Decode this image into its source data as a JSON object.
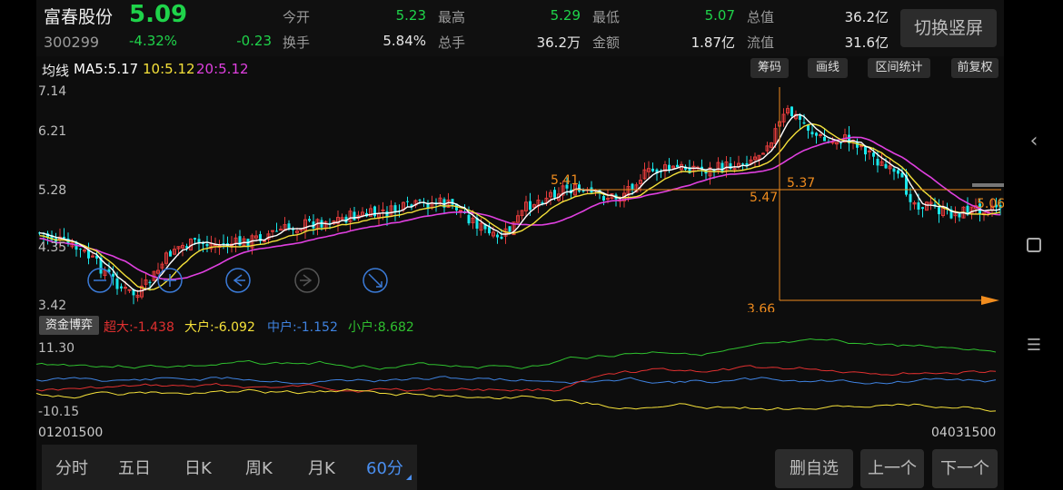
{
  "stock": {
    "name": "富春股份",
    "code": "300299",
    "price": "5.09",
    "change_pct": "-4.32%",
    "change": "-0.23"
  },
  "stats": [
    {
      "label": "今开",
      "value": "5.23",
      "color": "#1fd34a"
    },
    {
      "label": "最高",
      "value": "5.29",
      "color": "#1fd34a"
    },
    {
      "label": "最低",
      "value": "5.07",
      "color": "#1fd34a"
    },
    {
      "label": "总值",
      "value": "36.2亿",
      "color": "#e6e6e6"
    },
    {
      "label": "换手",
      "value": "5.84%",
      "color": "#e6e6e6"
    },
    {
      "label": "总手",
      "value": "36.2万",
      "color": "#e6e6e6"
    },
    {
      "label": "金额",
      "value": "1.87亿",
      "color": "#e6e6e6"
    },
    {
      "label": "流值",
      "value": "31.6亿",
      "color": "#e6e6e6"
    }
  ],
  "switch_button": "切换竖屏",
  "ma": {
    "title": "均线",
    "ma5": "MA5:5.17",
    "ma10": "10:5.12",
    "ma20": "20:5.12",
    "ma5_color": "#ffffff",
    "ma10_color": "#f5e13a",
    "ma20_color": "#e040e0"
  },
  "tools": [
    "筹码",
    "画线",
    "区间统计",
    "前复权"
  ],
  "price_axis": [
    "7.14",
    "6.21",
    "5.28",
    "4.35",
    "3.42"
  ],
  "annotations": {
    "label_541": "5.41",
    "label_537": "5.37",
    "label_547": "5.47",
    "label_366": "3.66",
    "label_506": "5.06"
  },
  "fund": {
    "button": "资金博弈",
    "super": "超大:-1.438",
    "big": "大户:-6.092",
    "mid": "中户:-1.152",
    "small": "小户:8.682",
    "axis_top": "11.30",
    "axis_bottom": "-10.15",
    "colors": {
      "super": "#e03030",
      "big": "#f5e13a",
      "mid": "#3f82e0",
      "small": "#2fbf2f"
    }
  },
  "time_axis": {
    "start": "01201500",
    "end": "04031500"
  },
  "period_tabs": [
    "分时",
    "五日",
    "日K",
    "周K",
    "月K",
    "60分"
  ],
  "active_tab": "60分",
  "actions": [
    "删自选",
    "上一个",
    "下一个"
  ],
  "colors": {
    "up": "#e23b3b",
    "down": "#19e6ea",
    "accent": "#f08c1e",
    "green": "#1fd34a"
  }
}
